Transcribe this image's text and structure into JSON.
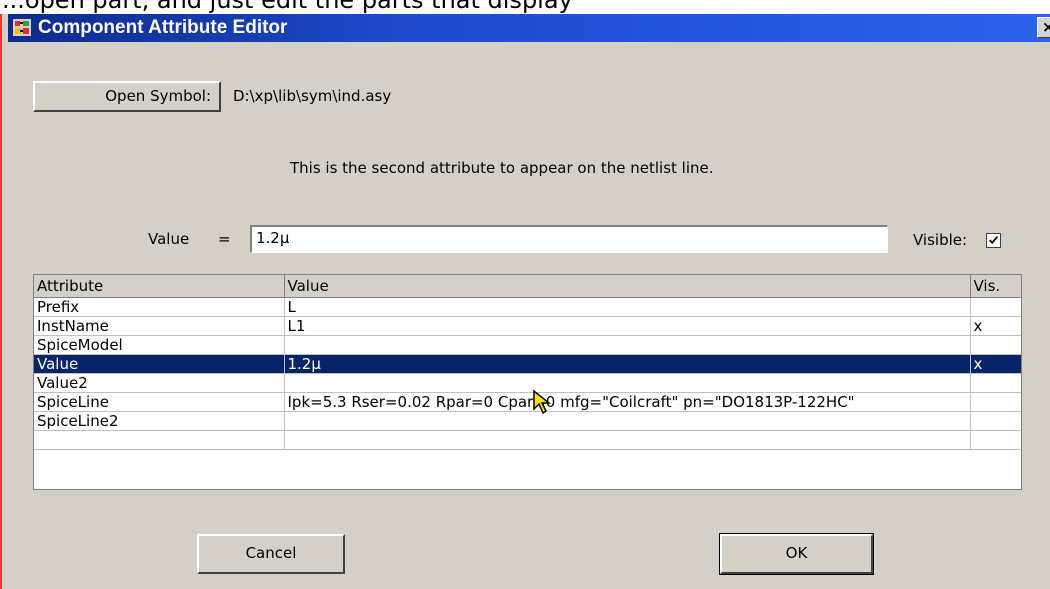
{
  "top_strip_text": "...open part, and just edit the parts that display",
  "window": {
    "title": "Component Attribute Editor",
    "close_label": "×"
  },
  "symbol": {
    "open_label": "Open Symbol:",
    "path": "D:\\xp\\lib\\sym\\ind.asy"
  },
  "hint": "This is the second attribute to appear on the netlist line.",
  "editor": {
    "label": "Value",
    "equals": "=",
    "value": "1.2µ",
    "visible_label": "Visible:",
    "visible_checked": true
  },
  "table": {
    "headers": [
      "Attribute",
      "Value",
      "Vis."
    ],
    "rows": [
      {
        "attribute": "Prefix",
        "value": "L",
        "vis": ""
      },
      {
        "attribute": "InstName",
        "value": "L1",
        "vis": "x"
      },
      {
        "attribute": "SpiceModel",
        "value": "",
        "vis": ""
      },
      {
        "attribute": "Value",
        "value": "1.2µ",
        "vis": "x"
      },
      {
        "attribute": "Value2",
        "value": "",
        "vis": ""
      },
      {
        "attribute": "SpiceLine",
        "value": "Ipk=5.3 Rser=0.02 Rpar=0 Cpar=0 mfg=\"Coilcraft\" pn=\"DO1813P-122HC\"",
        "vis": ""
      },
      {
        "attribute": "SpiceLine2",
        "value": "",
        "vis": ""
      },
      {
        "attribute": "",
        "value": "",
        "vis": ""
      }
    ],
    "selected_row": 3
  },
  "buttons": {
    "cancel": "Cancel",
    "ok": "OK"
  },
  "colors": {
    "titlebar": "#1f4bd0",
    "face": "#d4d0c8",
    "selection": "#0a246a"
  },
  "icons": {
    "app": "component-app-icon",
    "cursor": "mouse-pointer-icon"
  }
}
